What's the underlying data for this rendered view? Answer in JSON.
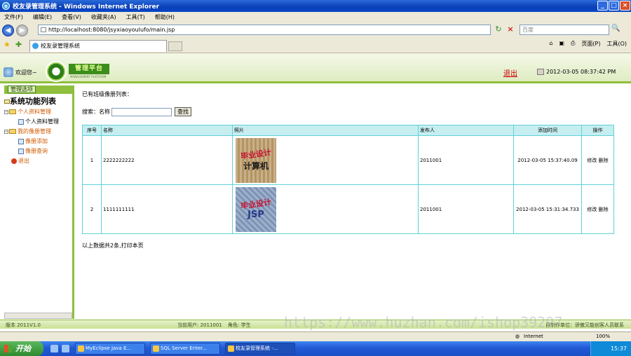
{
  "window": {
    "title": "校友录管理系统 - Windows Internet Explorer"
  },
  "menubar": [
    "文件(F)",
    "编辑(E)",
    "查看(V)",
    "收藏夹(A)",
    "工具(T)",
    "帮助(H)"
  ],
  "address": {
    "url": "http://localhost:8080/jsyxiaoyoulufo/main.jsp",
    "search_placeholder": "百度"
  },
  "tab": {
    "title": "校友录管理系统"
  },
  "commandbar": [
    "页面(P)",
    "工具(O)"
  ],
  "header": {
    "welcome": "欢迎您~",
    "logo_text": "管理平台",
    "logo_sub": "MANAGEMENT PLATFORM",
    "logout": "退出",
    "datetime": "2012-03-05 08:37:42 PM"
  },
  "sidebar": {
    "header": "管理选项",
    "root": "系统功能列表",
    "groups": [
      {
        "label": "个人资料管理",
        "items": [
          "个人资料管理"
        ]
      },
      {
        "label": "我的像册管理",
        "items": [
          "像册添加",
          "像册查询"
        ]
      }
    ],
    "exit": "退出"
  },
  "main": {
    "list_title": "已有班级像册列表：",
    "search_label": "搜索：",
    "name_label": "名称",
    "search_button": "查找",
    "columns": [
      "序号",
      "名称",
      "照片",
      "发布人",
      "添加时间",
      "操作"
    ],
    "rows": [
      {
        "no": "1",
        "name": "2222222222",
        "photo_line1": "毕业设计",
        "photo_line2": "计算机",
        "publisher": "2011001",
        "time": "2012-03-05 15:37:40.09",
        "edit": "修改",
        "delete": "删除"
      },
      {
        "no": "2",
        "name": "1111111111",
        "photo_line1": "毕业设计",
        "photo_line2": "JSP",
        "publisher": "2011001",
        "time": "2012-03-05 15:31:34.733",
        "edit": "修改",
        "delete": "删除"
      }
    ],
    "summary": "以上数据共2条,打印本页"
  },
  "appstatus": {
    "version": "版本 2011V1.0",
    "current_user": "当前用户: 2011001",
    "role": "角色: 学生",
    "right": "目制作单位：骄傲又能创客人员联系"
  },
  "iestatus": {
    "zone": "Internet",
    "zoom": "100%"
  },
  "taskbar": {
    "start": "开始",
    "tasks": [
      "MyEclipse Java E...",
      "SQL Server Enter...",
      "校友录管理系统 -..."
    ],
    "clock": "15:37"
  },
  "watermark": "https://www.huzhan.com/ishop39297"
}
